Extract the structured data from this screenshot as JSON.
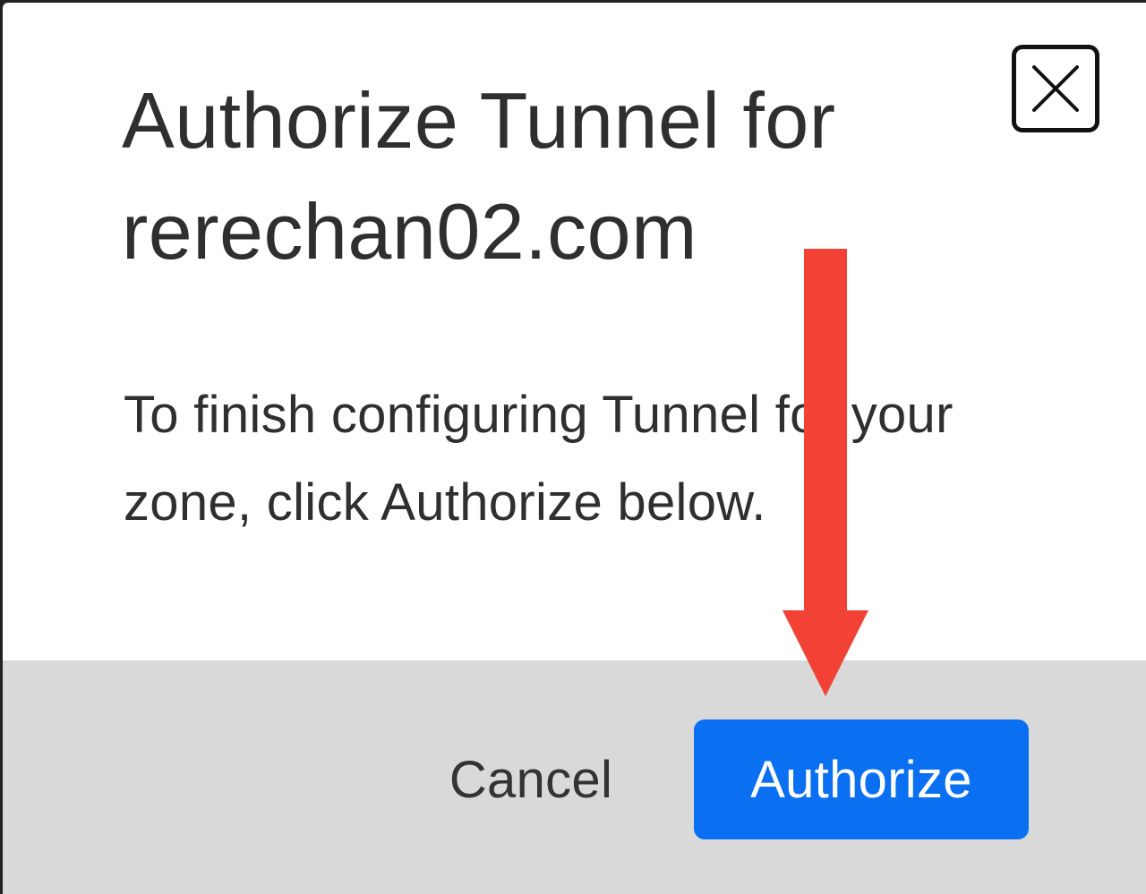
{
  "dialog": {
    "title": "Authorize Tunnel for rerechan02.com",
    "message": "To finish configuring Tunnel for your zone, click Authorize below.",
    "close_icon": "close-icon"
  },
  "footer": {
    "cancel_label": "Cancel",
    "authorize_label": "Authorize"
  },
  "colors": {
    "primary": "#0a6ff0",
    "footer_bg": "#d9d9d9",
    "annotation_arrow": "#f24236",
    "text": "#2f2f2f"
  }
}
